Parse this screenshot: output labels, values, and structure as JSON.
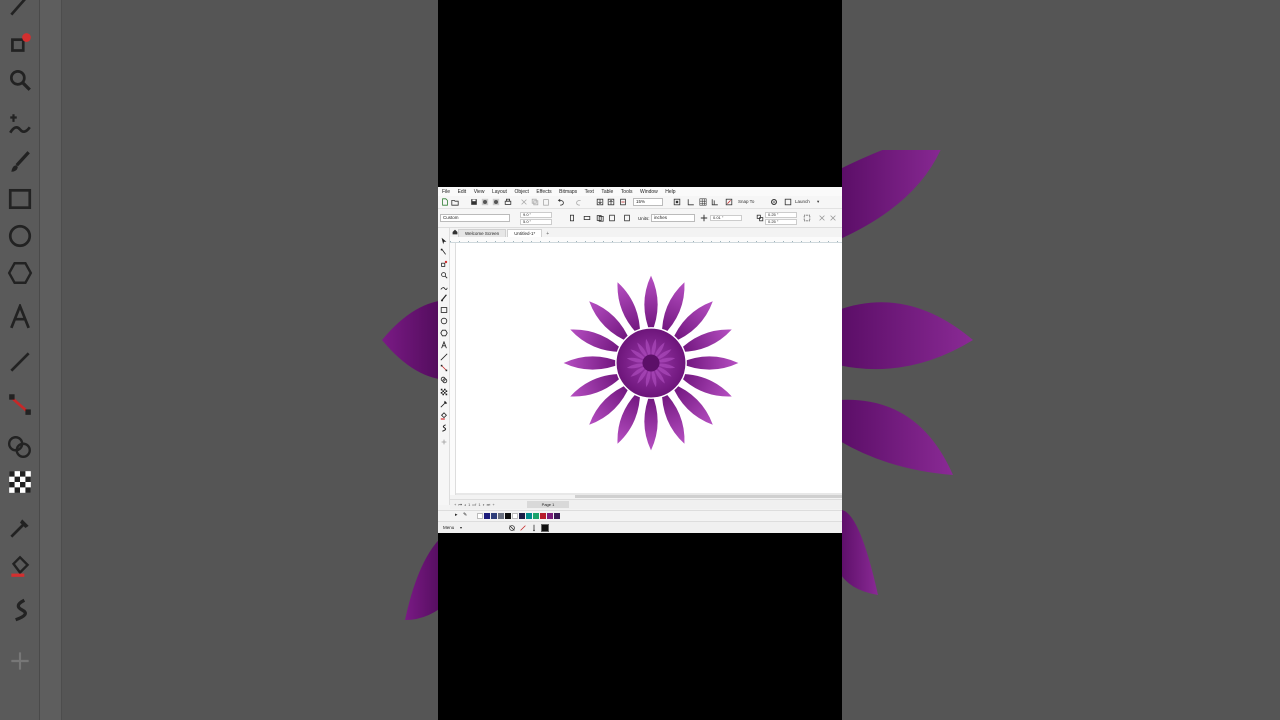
{
  "window": {
    "active_document": "Untitled-1*"
  },
  "menubar": {
    "items": [
      "File",
      "Edit",
      "View",
      "Layout",
      "Object",
      "Effects",
      "Bitmaps",
      "Text",
      "Table",
      "Tools",
      "Window",
      "Help"
    ]
  },
  "toolbar": {
    "zoom_level": "15%",
    "snap_to_label": "Snap To",
    "launch_label": "Launch"
  },
  "property_bar": {
    "page_preset": "Custom",
    "width_value": "9.0 \"",
    "height_value": "5.0 \"",
    "units_label": "Units:",
    "units_value": "inches",
    "nudge_value": "0.01 \"",
    "dup_x_value": "0.25 \"",
    "dup_y_value": "0.25 \""
  },
  "tabs": [
    "Welcome Screen",
    "Untitled-1*"
  ],
  "pagebar": {
    "page_counter": "1 of 1",
    "page_tab_label": "Page 1"
  },
  "status": {
    "menu_label": "Menu"
  },
  "colors": {
    "petal_dark": "#6a1077",
    "petal_light": "#b64fc2",
    "center": "#7e1f8d",
    "palette": [
      "#ffffff",
      "#1a1a7a",
      "#2f3e7a",
      "#6a7080",
      "#101010",
      "#ffffff",
      "#1b1b45",
      "#008c8c",
      "#19a36a",
      "#b71c2c",
      "#7a1d7a",
      "#3a1a55"
    ]
  }
}
